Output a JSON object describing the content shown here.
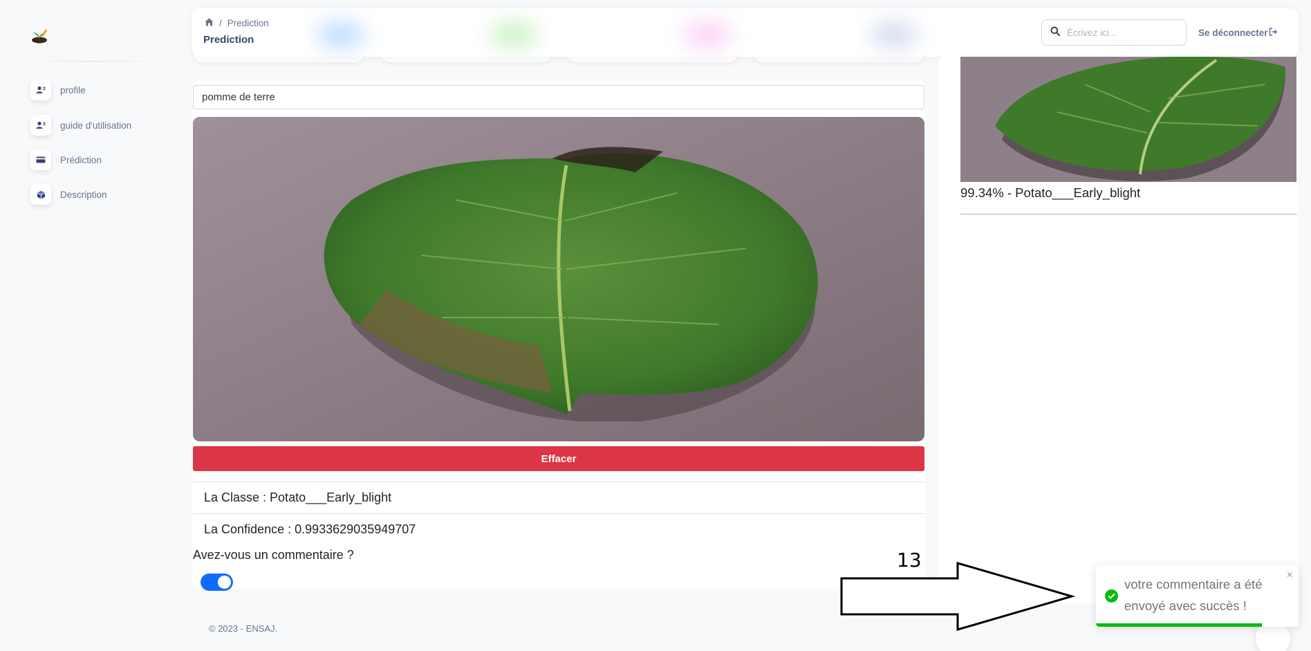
{
  "sidebar": {
    "items": [
      {
        "label": "profile",
        "icon": "user-settings-icon"
      },
      {
        "label": "guide d'utilisation",
        "icon": "user-settings-icon"
      },
      {
        "label": "Prédiction",
        "icon": "credit-card-icon"
      },
      {
        "label": "Description",
        "icon": "box-icon"
      }
    ]
  },
  "header": {
    "breadcrumb_current": "Prediction",
    "title": "Prediction",
    "search_placeholder": "Écrivez ici...",
    "logout_label": "Se déconnecter"
  },
  "main": {
    "species_value": "pomme de terre",
    "clear_label": "Effacer",
    "class_text": "La Classe : Potato___Early_blight",
    "confidence_text": "La Confidence : 0.9933629035949707",
    "comment_question": "Avez-vous un commentaire ?",
    "comment_toggle_on": true
  },
  "history": {
    "items": [
      {
        "caption": "99.34% - Potato___Early_blight"
      }
    ]
  },
  "annotation": {
    "step_number": "13"
  },
  "toast": {
    "message": "votre commentaire a été envoyé avec succès !",
    "close_glyph": "×",
    "progress": 0.82,
    "color": "#07bc0c"
  },
  "footer": {
    "text": "© 2023  - ENSAJ."
  },
  "colors": {
    "accent": "#0d6efd",
    "danger": "#dc3545",
    "text_dark": "#344767",
    "text_muted": "#67748e"
  }
}
